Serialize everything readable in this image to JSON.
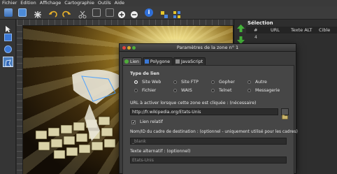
{
  "menubar": {
    "items": [
      "Fichier",
      "Edition",
      "Affichage",
      "Cartographie",
      "Outils",
      "Aide"
    ]
  },
  "toolbar": {
    "icons": [
      "open-folder-icon",
      "save-icon",
      "settings-icon",
      "undo-icon",
      "redo-icon",
      "cut-icon",
      "copy-icon",
      "paste-icon",
      "zoom-in-icon",
      "zoom-out-icon",
      "info-icon",
      "edit-zones-icon",
      "grid-icon"
    ]
  },
  "tools": [
    "pointer-icon",
    "rectangle-tool-icon",
    "circle-tool-icon",
    "polygon-tool-icon"
  ],
  "selection_panel": {
    "title": "Sélection",
    "columns": [
      "#",
      "URL",
      "Texte ALT",
      "Cible"
    ],
    "row_marker": "4"
  },
  "dialog": {
    "title": "Paramètres de la zone n° 1",
    "tabs": [
      "Lien",
      "Polygone",
      "JavaScript"
    ],
    "link_type": {
      "heading": "Type de lien",
      "options": [
        {
          "label": "Site Web",
          "selected": true
        },
        {
          "label": "Site FTP",
          "selected": false
        },
        {
          "label": "Gopher",
          "selected": false
        },
        {
          "label": "Autre",
          "selected": false
        },
        {
          "label": "Fichier",
          "selected": false
        },
        {
          "label": "WAIS",
          "selected": false
        },
        {
          "label": "Telnet",
          "selected": false
        },
        {
          "label": "Messagerie",
          "selected": false
        }
      ]
    },
    "url_label": "URL à activer lorsque cette zone est cliquée : (nécessaire)",
    "url_value": "http://fr.wikipedia.org/Etats-Unis",
    "relative_link_label": "Lien relatif",
    "relative_link_checked": true,
    "target_label": "Nom/ID du cadre de destination : (optionnel - uniquement utilisé pour les cadres)",
    "target_value": "_blank",
    "alt_label": "Texte alternatif : (optionnel)",
    "alt_value": "Etats-Unis"
  },
  "colors": {
    "accent_blue": "#2f6fd8",
    "toolbar_bg": "#3c3c3c",
    "dialog_bg": "#3b3b3b"
  }
}
